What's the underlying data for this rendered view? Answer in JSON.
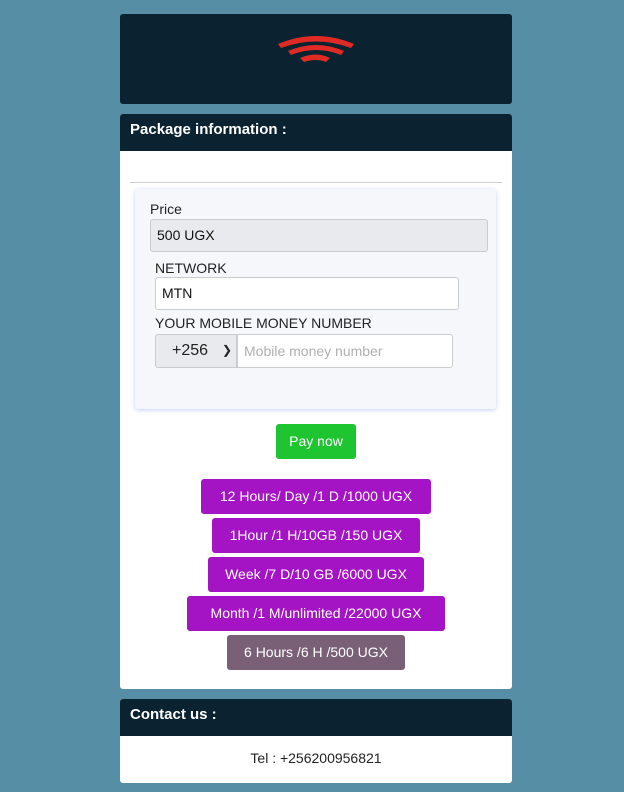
{
  "header": {
    "logo_icon": "wifi-signal-icon",
    "logo_color": "#e02b24"
  },
  "package": {
    "title": "Package information :",
    "price_label": "Price",
    "price_value": "500 UGX",
    "network_label": "NETWORK",
    "network_value": "MTN",
    "mm_label": "YOUR MOBILE MONEY NUMBER",
    "country_code": "+256",
    "mm_placeholder": "Mobile money number",
    "pay_label": "Pay now"
  },
  "packages": [
    {
      "label": "12 Hours/ Day /1 D /1000 UGX"
    },
    {
      "label": "1Hour /1 H/10GB /150 UGX"
    },
    {
      "label": "Week /7 D/10 GB /6000 UGX"
    },
    {
      "label": "Month /1 M/unlimited /22000 UGX"
    },
    {
      "label": "6 Hours /6 H /500 UGX"
    }
  ],
  "colors": {
    "background": "#568ea6",
    "header": "#0b2231",
    "pay_button": "#1fc431",
    "package_button": "#a514c4",
    "package_selected": "#7a6076"
  },
  "contact": {
    "title": "Contact us :",
    "tel": "Tel : +256200956821"
  }
}
